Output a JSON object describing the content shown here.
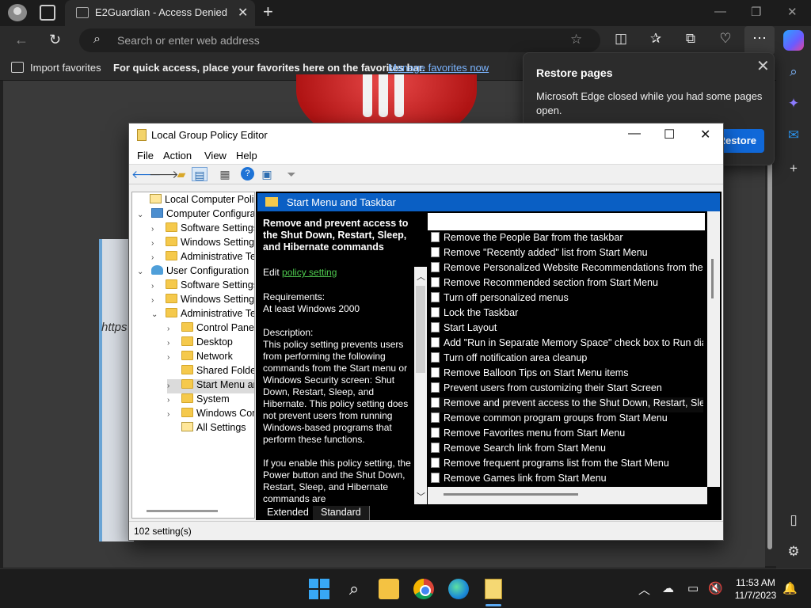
{
  "browser": {
    "tab_title": "E2Guardian - Access Denied",
    "address_placeholder": "Search or enter web address",
    "favbar": {
      "import_label": "Import favorites",
      "message": "For quick access, place your favorites here on the favorites bar.",
      "manage_link": "Manage favorites now"
    },
    "restore_popup": {
      "title": "Restore pages",
      "message": "Microsoft Edge closed while you had some pages open.",
      "button": "Restore"
    },
    "page_fragment_text": "https"
  },
  "gpe": {
    "title": "Local Group Policy Editor",
    "menu": [
      "File",
      "Action",
      "View",
      "Help"
    ],
    "tree": [
      {
        "label": "Local Computer Policy",
        "icon": "policy",
        "arrow": ""
      },
      {
        "label": "Computer Configuration",
        "icon": "comp",
        "arrow": "v"
      },
      {
        "label": "Software Settings",
        "icon": "folder",
        "arrow": ">"
      },
      {
        "label": "Windows Settings",
        "icon": "folder",
        "arrow": ">"
      },
      {
        "label": "Administrative Templates",
        "icon": "folder",
        "arrow": ">"
      },
      {
        "label": "User Configuration",
        "icon": "user",
        "arrow": "v"
      },
      {
        "label": "Software Settings",
        "icon": "folder",
        "arrow": ">"
      },
      {
        "label": "Windows Settings",
        "icon": "folder",
        "arrow": ">"
      },
      {
        "label": "Administrative Templates",
        "icon": "folder",
        "arrow": "v"
      },
      {
        "label": "Control Panel",
        "icon": "folder",
        "arrow": ">"
      },
      {
        "label": "Desktop",
        "icon": "folder",
        "arrow": ">"
      },
      {
        "label": "Network",
        "icon": "folder",
        "arrow": ">"
      },
      {
        "label": "Shared Folders",
        "icon": "folder",
        "arrow": ""
      },
      {
        "label": "Start Menu and Taskbar",
        "icon": "folder",
        "arrow": ">"
      },
      {
        "label": "System",
        "icon": "folder",
        "arrow": ">"
      },
      {
        "label": "Windows Components",
        "icon": "folder",
        "arrow": ">"
      },
      {
        "label": "All Settings",
        "icon": "policy",
        "arrow": ""
      }
    ],
    "pane_header": "Start Menu and Taskbar",
    "extended": {
      "title": "Remove and prevent access to the Shut Down, Restart, Sleep, and Hibernate commands",
      "edit_prefix": "Edit ",
      "edit_link": "policy setting",
      "req_label": "Requirements:",
      "req_value": "At least Windows 2000",
      "desc_label": "Description:",
      "desc_text": "This policy setting prevents users from performing the following commands from the Start menu or Windows Security screen: Shut Down, Restart, Sleep, and Hibernate. This policy setting does not prevent users from running Windows-based programs that perform these functions.",
      "desc_text2": "If you enable this policy setting, the Power button and the Shut Down, Restart, Sleep, and Hibernate commands are"
    },
    "settings": [
      "Remove the People Bar from the taskbar",
      "Remove \"Recently added\" list from Start Menu",
      "Remove Personalized Website Recommendations from the ...",
      "Remove Recommended section from Start Menu",
      "Turn off personalized menus",
      "Lock the Taskbar",
      "Start Layout",
      "Add \"Run in Separate Memory Space\" check box to Run dial...",
      "Turn off notification area cleanup",
      "Remove Balloon Tips on Start Menu items",
      "Prevent users from customizing their Start Screen",
      "Remove and prevent access to the Shut Down, Restart, Sleep...",
      "Remove common program groups from Start Menu",
      "Remove Favorites menu from Start Menu",
      "Remove Search link from Start Menu",
      "Remove frequent programs list from the Start Menu",
      "Remove Games link from Start Menu"
    ],
    "tabs": [
      "Extended",
      "Standard"
    ],
    "status": "102 setting(s)"
  },
  "taskbar": {
    "time": "11:53 AM",
    "date": "11/7/2023"
  }
}
